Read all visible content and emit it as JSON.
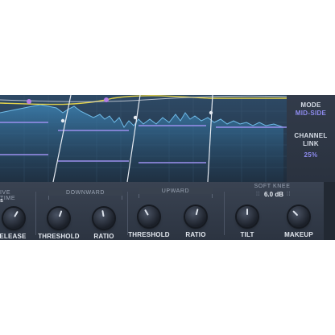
{
  "side_panel": {
    "mode_label": "MODE",
    "mode_value": "MID-SIDE",
    "channel_link_label_1": "CHANNEL",
    "channel_link_label_2": "LINK",
    "channel_link_value": "25%"
  },
  "controls": {
    "partial_group": "IVE TIME",
    "partial_value": "s",
    "release_label": "RELEASE",
    "downward_group": "DOWNWARD",
    "upward_group": "UPWARD",
    "threshold_down_label": "THRESHOLD",
    "ratio_down_label": "RATIO",
    "threshold_up_label": "THRESHOLD",
    "ratio_up_label": "RATIO",
    "soft_knee_label": "SOFT KNEE",
    "soft_knee_value": "6.0 dB",
    "tilt_label": "TILT",
    "makeup_label": "MAKEUP"
  },
  "colors": {
    "accent_purple": "#8f8cf0",
    "spectrum_blue": "#4fa3d9",
    "curve_yellow": "#e3d24a"
  }
}
